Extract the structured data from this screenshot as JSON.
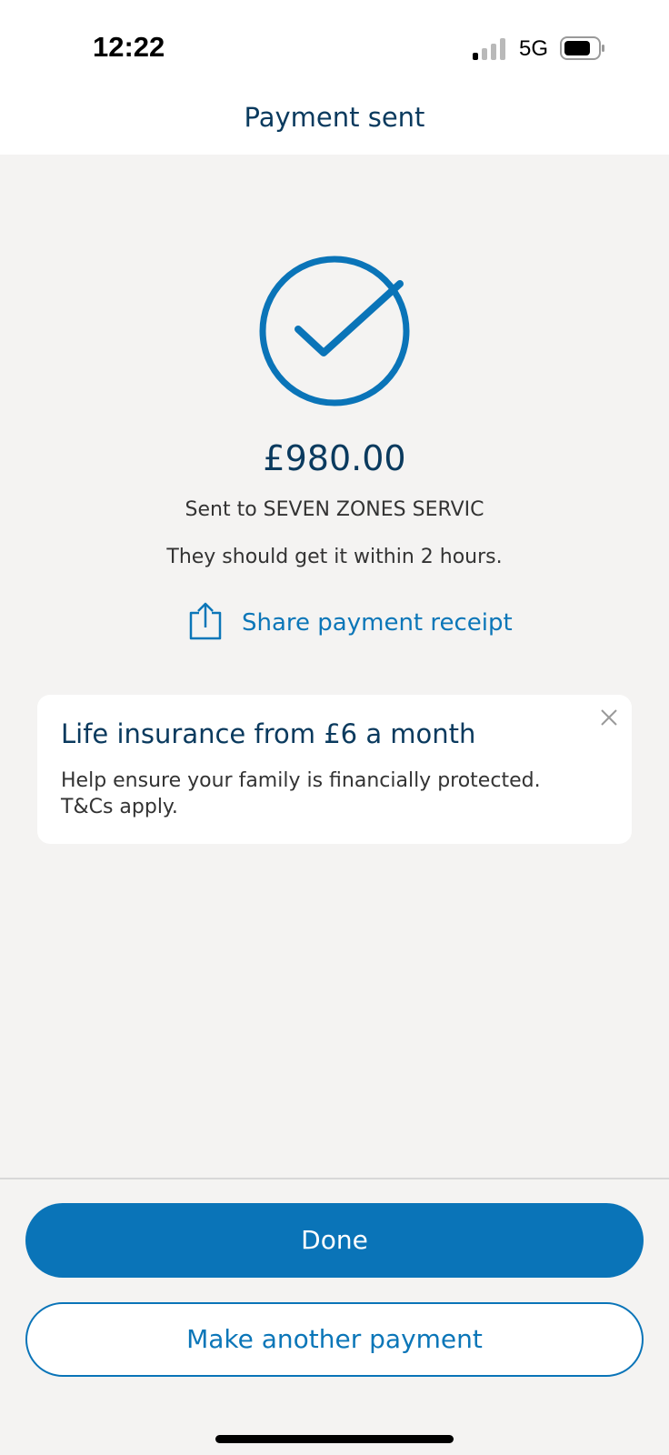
{
  "status_bar": {
    "time": "12:22",
    "network": "5G",
    "signal_bars_active": 1,
    "signal_bars_total": 4
  },
  "header": {
    "title": "Payment sent"
  },
  "confirmation": {
    "icon": "check-circle-icon",
    "amount": "£980.00",
    "sent_to": "Sent to SEVEN ZONES SERVIC",
    "eta": "They should get it within 2 hours.",
    "share_icon": "share-icon",
    "share_label": "Share payment receipt"
  },
  "promo": {
    "title": "Life insurance from £6 a month",
    "body": "Help ensure your family is financially protected. T&Cs apply.",
    "close_icon": "close-icon"
  },
  "actions": {
    "done_label": "Done",
    "another_label": "Make another payment"
  },
  "colors": {
    "primary": "#0a74b8",
    "heading": "#0a3a5e",
    "background": "#f4f3f2"
  }
}
